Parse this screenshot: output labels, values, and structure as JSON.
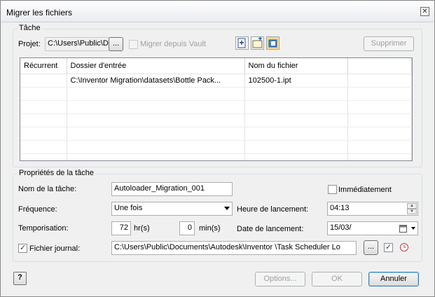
{
  "window": {
    "title": "Migrer les fichiers",
    "close_glyph": "✕"
  },
  "task_group": {
    "title": "Tâche",
    "project_label": "Projet:",
    "project_value": "C:\\Users\\Public\\D",
    "browse_label": "...",
    "vault_label": "Migrer depuis Vault",
    "delete_label": "Supprimer"
  },
  "grid": {
    "columns": [
      "Récurrent",
      "Dossier d'entrée",
      "Nom du fichier",
      ""
    ],
    "rows": [
      {
        "recurrent": "",
        "folder": "C:\\Inventor Migration\\datasets\\Bottle Pack...",
        "file": "102500-1.ipt",
        "extra": ""
      }
    ]
  },
  "props": {
    "title": "Propriétés de la tâche",
    "task_name_label": "Nom de la tâche:",
    "task_name_value": "Autoloader_Migration_001",
    "immediate_label": "Immédiatement",
    "frequency_label": "Fréquence:",
    "frequency_value": "Une fois",
    "start_time_label": "Heure de lancement:",
    "start_time_value": "04:13",
    "delay_label": "Temporisation:",
    "delay_hours": "72",
    "hours_unit": "hr(s)",
    "delay_minutes": "0",
    "minutes_unit": "min(s)",
    "start_date_label": "Date de lancement:",
    "start_date_value": "15/03/",
    "log_label": "Fichier journal:",
    "log_value": "C:\\Users\\Public\\Documents\\Autodesk\\Inventor          \\Task Scheduler Lo",
    "log_browse": "..."
  },
  "footer": {
    "help_glyph": "?",
    "options_label": "Options...",
    "ok_label": "OK",
    "cancel_label": "Annuler"
  },
  "icons": {
    "new_task": "add-file-icon",
    "add_folder": "add-folder-icon",
    "add_multiple": "add-multiple-icon"
  }
}
